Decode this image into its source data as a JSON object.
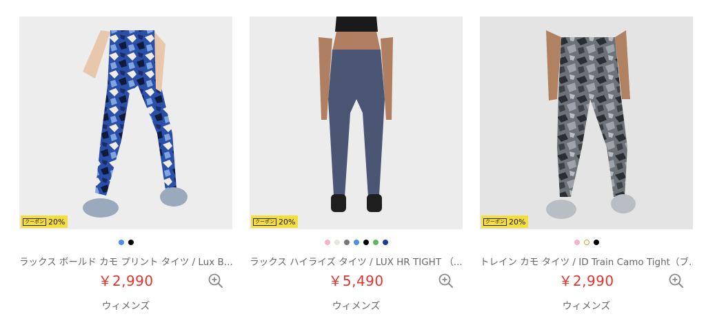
{
  "products": [
    {
      "coupon_tag": "クーポン",
      "coupon_value": "20%",
      "swatches": [
        "#4a90e2",
        "#000000"
      ],
      "name": "ラックス ボールド カモ プリント タイツ / Lux B...",
      "price": "￥2,990",
      "gender": "ウィメンズ",
      "image_icon": "product-photo-camo-blue-tights"
    },
    {
      "coupon_tag": "クーポン",
      "coupon_value": "20%",
      "swatches": [
        "#f4b5c8",
        "#e8e6dc",
        "#777777",
        "#4a90e2",
        "#000000",
        "#5cb85c",
        "#1f3a93"
      ],
      "name": "ラックス ハイライズ タイツ / LUX HR TIGHT （...",
      "price": "￥5,490",
      "gender": "ウィメンズ",
      "image_icon": "product-photo-navy-tights"
    },
    {
      "coupon_tag": "クーポン",
      "coupon_value": "20%",
      "swatches": [
        "#f4b5c8",
        "#ffffff",
        "#000000"
      ],
      "name": "トレイン カモ タイツ / ID Train Camo Tight（ブ...",
      "price": "￥2,990",
      "gender": "ウィメンズ",
      "image_icon": "product-photo-grey-camo-tights"
    }
  ],
  "icons": {
    "zoom": "zoom-in-icon"
  }
}
